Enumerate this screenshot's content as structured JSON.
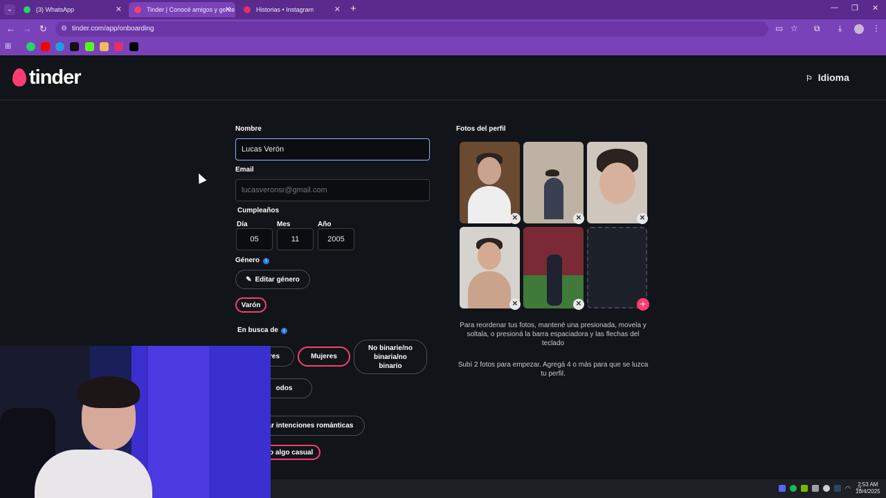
{
  "browser": {
    "tabs": [
      {
        "title": "(3) WhatsApp",
        "icon": "whatsapp-icon",
        "color": "#25d366"
      },
      {
        "title": "Tinder | Conocé amigos y gente",
        "icon": "tinder-icon",
        "color": "#fe3c72"
      },
      {
        "title": "Historias • Instagram",
        "icon": "instagram-icon",
        "color": "#e1306c"
      }
    ],
    "url": "tinder.com/app/onboarding",
    "bookmarks": [
      "whatsapp-icon",
      "youtube-icon",
      "edge-icon",
      "tiktok-icon",
      "kick-icon",
      "mail-icon",
      "instagram-icon",
      "x-icon"
    ]
  },
  "header": {
    "logo_text": "tinder",
    "language_label": "Idioma"
  },
  "form": {
    "name_label": "Nombre",
    "name_value": "Lucas Verón",
    "email_label": "Email",
    "email_placeholder": "lucasveronsr@gmail.com",
    "birthday_label": "Cumpleaños",
    "day_label": "Día",
    "day_value": "05",
    "month_label": "Mes",
    "month_value": "11",
    "year_label": "Año",
    "year_value": "2005",
    "gender_label": "Género",
    "edit_gender_label": "Editar género",
    "gender_value": "Varón",
    "seeking_label": "En busca de",
    "seeking_options": [
      "res",
      "Mujeres",
      "No binarie/no binaria/no binario",
      "odos"
    ],
    "intent_option": "ar intenciones románticas",
    "casual_option": "a o algo casual"
  },
  "photos": {
    "label": "Fotos del perfil",
    "reorder_help": "Para reordenar tus fotos, mantené una presionada, movela y soltala, o presioná la barra espaciadora y las flechas del teclado",
    "upload_help": "Subí 2 fotos para empezar. Agregá 4 o más para que se luzca tu perfil."
  },
  "system": {
    "time": "2:53 AM",
    "date": "10/4/2025"
  },
  "colors": {
    "accent": "#fe3c72",
    "browser_frame": "#7a42b8"
  }
}
